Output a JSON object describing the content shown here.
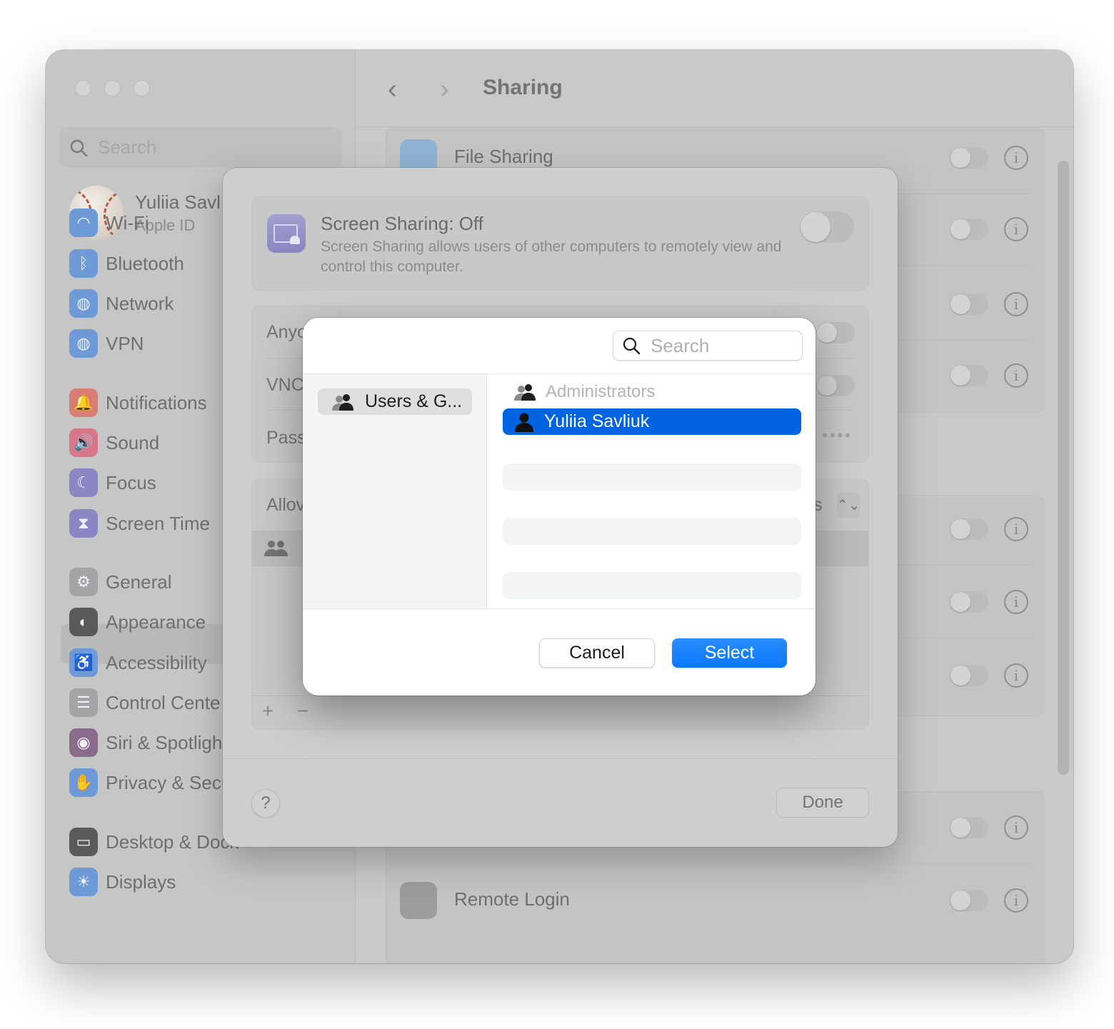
{
  "window": {
    "title": "Sharing",
    "nav": {
      "back": "‹",
      "forward": "›"
    }
  },
  "sidebar": {
    "search_placeholder": "Search",
    "profile": {
      "name": "Yuliia Savl",
      "subtitle": "Apple ID"
    },
    "items": [
      {
        "label": "Wi-Fi",
        "icon": "wifi-icon",
        "color": "#6e9bd8",
        "glyph": "◠"
      },
      {
        "label": "Bluetooth",
        "icon": "bluetooth-icon",
        "color": "#6e9bd8",
        "glyph": "ᛒ"
      },
      {
        "label": "Network",
        "icon": "globe-icon",
        "color": "#6e9bd8",
        "glyph": "◍"
      },
      {
        "label": "VPN",
        "icon": "vpn-globe-icon",
        "color": "#6e9bd8",
        "glyph": "◍"
      },
      {
        "label": "Notifications",
        "icon": "bell-icon",
        "color": "#d97c74",
        "glyph": "🔔"
      },
      {
        "label": "Sound",
        "icon": "speaker-icon",
        "color": "#d87789",
        "glyph": "🔊"
      },
      {
        "label": "Focus",
        "icon": "moon-icon",
        "color": "#8b86c4",
        "glyph": "☾"
      },
      {
        "label": "Screen Time",
        "icon": "hourglass-icon",
        "color": "#8b86c4",
        "glyph": "⧗"
      },
      {
        "label": "General",
        "icon": "gear-icon",
        "color": "#a4a4a4",
        "glyph": "⚙",
        "selected": true
      },
      {
        "label": "Appearance",
        "icon": "appearance-icon",
        "color": "#5a5a5a",
        "glyph": "◐"
      },
      {
        "label": "Accessibility",
        "icon": "accessibility-icon",
        "color": "#6e9bd8",
        "glyph": "♿"
      },
      {
        "label": "Control Cente",
        "icon": "control-center-icon",
        "color": "#a4a4a4",
        "glyph": "☰"
      },
      {
        "label": "Siri & Spotligh",
        "icon": "siri-icon",
        "color": "#8a6c8a",
        "glyph": "◉"
      },
      {
        "label": "Privacy & Security",
        "icon": "hand-icon",
        "color": "#6e9bd8",
        "glyph": "✋"
      },
      {
        "label": "Desktop & Dock",
        "icon": "dock-icon",
        "color": "#5a5a5a",
        "glyph": "▭"
      },
      {
        "label": "Displays",
        "icon": "sun-icon",
        "color": "#6e9bd8",
        "glyph": "☀"
      }
    ]
  },
  "main": {
    "rows": [
      {
        "label": "File Sharing",
        "on": false
      },
      {
        "label": "",
        "on": false
      },
      {
        "label": "",
        "on": false
      },
      {
        "label": "",
        "on": false
      },
      {
        "label": "",
        "on": false
      },
      {
        "label": "",
        "on": false
      },
      {
        "label": "",
        "on": false
      },
      {
        "label": "",
        "on": false
      },
      {
        "label": "Remote Login",
        "on": false
      }
    ]
  },
  "sheet": {
    "screen_sharing": {
      "title": "Screen Sharing: Off",
      "description": "Screen Sharing allows users of other computers to remotely view and control this computer.",
      "on": false
    },
    "options": [
      {
        "label": "Anyo",
        "control": "toggle"
      },
      {
        "label": "VNC",
        "control": "toggle"
      },
      {
        "label": "Pass",
        "value": "••••"
      }
    ],
    "allow": {
      "label": "Allov",
      "selector_suffix": "s",
      "stepper": "⌃⌄"
    },
    "add_label": "+",
    "remove_label": "−",
    "help_label": "?",
    "done_label": "Done"
  },
  "dialog": {
    "search_placeholder": "Search",
    "sources": [
      {
        "label": "Users & G...",
        "selected": true
      }
    ],
    "group_label": "Administrators",
    "users": [
      {
        "label": "Yuliia Savliuk",
        "selected": true
      }
    ],
    "cancel_label": "Cancel",
    "select_label": "Select"
  }
}
